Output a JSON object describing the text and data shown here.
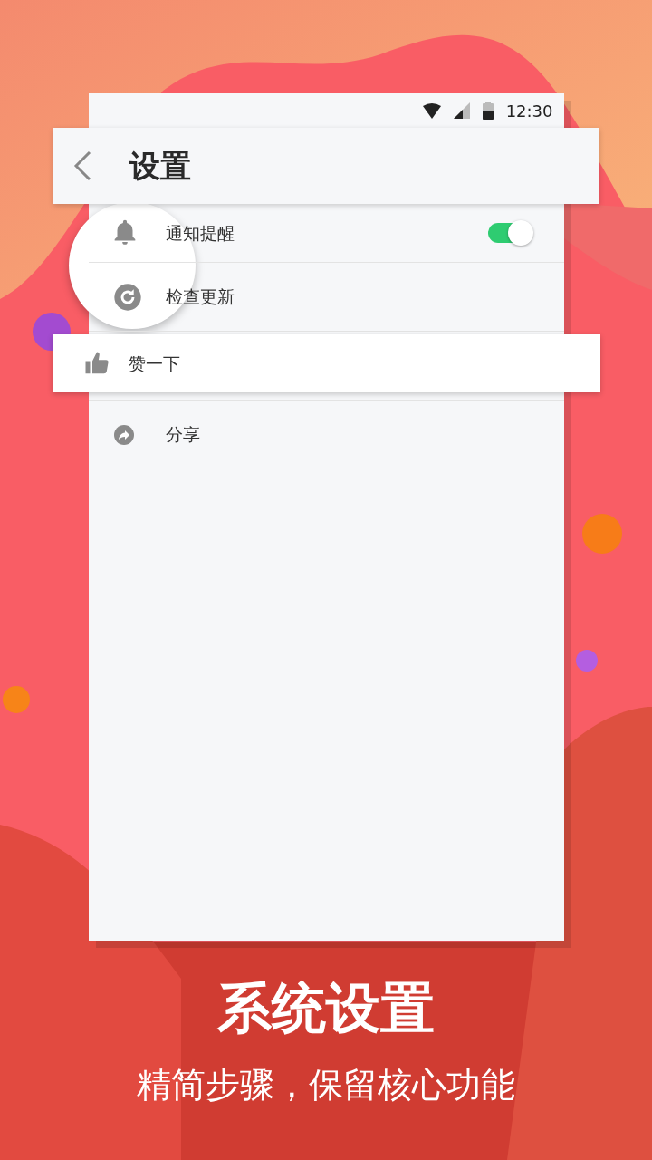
{
  "status_bar": {
    "time": "12:30"
  },
  "header": {
    "title": "设置"
  },
  "settings": [
    {
      "kind": "toggle",
      "label": "通知提醒",
      "on": true
    },
    {
      "kind": "link",
      "label": "检查更新"
    },
    {
      "kind": "raised",
      "label": "赞一下"
    },
    {
      "kind": "link",
      "label": "分享"
    }
  ],
  "caption": {
    "title": "系统设置",
    "subtitle": "精简步骤，保留核心功能"
  }
}
